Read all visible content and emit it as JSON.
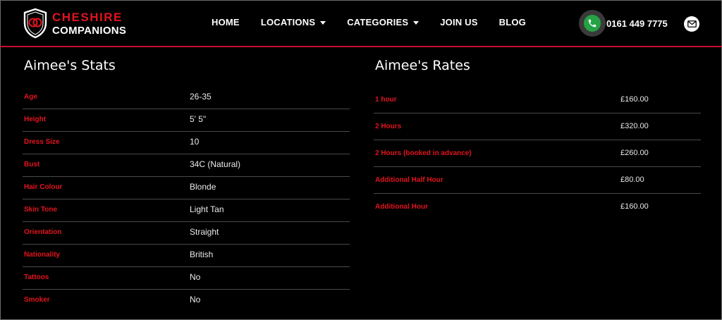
{
  "brand": {
    "line1": "CHESHIRE",
    "line2": "COMPANIONS",
    "accent_color": "#e1141e"
  },
  "nav": {
    "items": [
      {
        "label": "HOME",
        "dropdown": false
      },
      {
        "label": "LOCATIONS",
        "dropdown": true
      },
      {
        "label": "CATEGORIES",
        "dropdown": true
      },
      {
        "label": "JOIN US",
        "dropdown": false
      },
      {
        "label": "BLOG",
        "dropdown": false
      }
    ]
  },
  "contact": {
    "phone_icon": "phone-icon",
    "phone_number": "0161 449 7775",
    "mail_icon": "mail-icon"
  },
  "stats": {
    "title": "Aimee's Stats",
    "rows": [
      {
        "label": "Age",
        "value": "26-35"
      },
      {
        "label": "Height",
        "value": "5' 5\""
      },
      {
        "label": "Dress Size",
        "value": "10"
      },
      {
        "label": "Bust",
        "value": "34C (Natural)"
      },
      {
        "label": "Hair Colour",
        "value": "Blonde"
      },
      {
        "label": "Skin Tone",
        "value": "Light Tan"
      },
      {
        "label": "Orientation",
        "value": "Straight"
      },
      {
        "label": "Nationality",
        "value": "British"
      },
      {
        "label": "Tattoos",
        "value": "No"
      },
      {
        "label": "Smoker",
        "value": "No"
      }
    ]
  },
  "rates": {
    "title": "Aimee's Rates",
    "rows": [
      {
        "label": "1 hour",
        "value": "£160.00"
      },
      {
        "label": "2 Hours",
        "value": "£320.00"
      },
      {
        "label": "2 Hours (booked in advance)",
        "value": "£260.00"
      },
      {
        "label": "Additional Half Hour",
        "value": "£80.00"
      },
      {
        "label": "Additional Hour",
        "value": "£160.00"
      }
    ]
  }
}
